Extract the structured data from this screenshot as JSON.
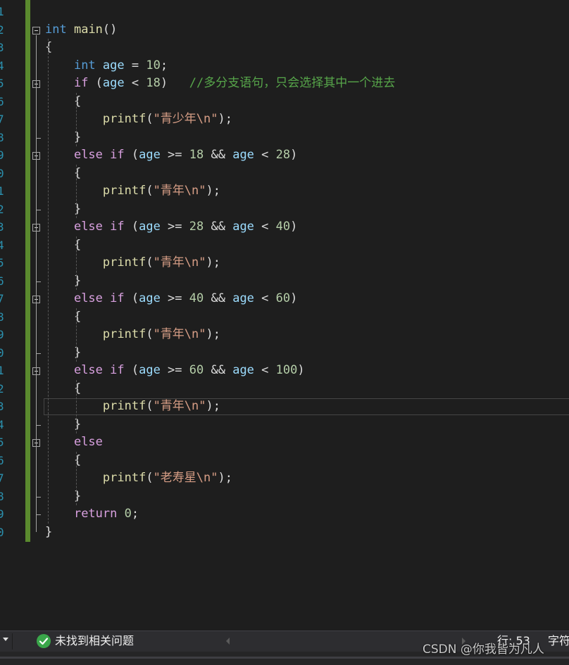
{
  "editor": {
    "line_numbers": [
      "1",
      "2",
      "3",
      "4",
      "5",
      "6",
      "7",
      "8",
      "9",
      "0",
      "1",
      "2",
      "3",
      "4",
      "5",
      "6",
      "7",
      "8",
      "9",
      "0",
      "1",
      "2",
      "3",
      "4",
      "5",
      "6",
      "7",
      "8",
      "9",
      "0"
    ],
    "lines": [
      [],
      [
        {
          "t": "kw",
          "v": "int"
        },
        {
          "t": "p",
          "v": " "
        },
        {
          "t": "fn",
          "v": "main"
        },
        {
          "t": "p",
          "v": "()"
        }
      ],
      [
        {
          "t": "p",
          "v": "{"
        }
      ],
      [
        {
          "t": "p",
          "v": "    "
        },
        {
          "t": "kw",
          "v": "int"
        },
        {
          "t": "p",
          "v": " "
        },
        {
          "t": "id",
          "v": "age"
        },
        {
          "t": "p",
          "v": " = "
        },
        {
          "t": "num",
          "v": "10"
        },
        {
          "t": "p",
          "v": ";"
        }
      ],
      [
        {
          "t": "p",
          "v": "    "
        },
        {
          "t": "ctl",
          "v": "if"
        },
        {
          "t": "p",
          "v": " ("
        },
        {
          "t": "id",
          "v": "age"
        },
        {
          "t": "p",
          "v": " < "
        },
        {
          "t": "num",
          "v": "18"
        },
        {
          "t": "p",
          "v": ")   "
        },
        {
          "t": "cm",
          "v": "//多分支语句，只会选择其中一个进去"
        }
      ],
      [
        {
          "t": "p",
          "v": "    {"
        }
      ],
      [
        {
          "t": "p",
          "v": "        "
        },
        {
          "t": "fn",
          "v": "printf"
        },
        {
          "t": "p",
          "v": "("
        },
        {
          "t": "str",
          "v": "\"青少年\\n\""
        },
        {
          "t": "p",
          "v": ");"
        }
      ],
      [
        {
          "t": "p",
          "v": "    }"
        }
      ],
      [
        {
          "t": "p",
          "v": "    "
        },
        {
          "t": "ctl",
          "v": "else if"
        },
        {
          "t": "p",
          "v": " ("
        },
        {
          "t": "id",
          "v": "age"
        },
        {
          "t": "p",
          "v": " >= "
        },
        {
          "t": "num",
          "v": "18"
        },
        {
          "t": "p",
          "v": " && "
        },
        {
          "t": "id",
          "v": "age"
        },
        {
          "t": "p",
          "v": " < "
        },
        {
          "t": "num",
          "v": "28"
        },
        {
          "t": "p",
          "v": ")"
        }
      ],
      [
        {
          "t": "p",
          "v": "    {"
        }
      ],
      [
        {
          "t": "p",
          "v": "        "
        },
        {
          "t": "fn",
          "v": "printf"
        },
        {
          "t": "p",
          "v": "("
        },
        {
          "t": "str",
          "v": "\"青年\\n\""
        },
        {
          "t": "p",
          "v": ");"
        }
      ],
      [
        {
          "t": "p",
          "v": "    }"
        }
      ],
      [
        {
          "t": "p",
          "v": "    "
        },
        {
          "t": "ctl",
          "v": "else if"
        },
        {
          "t": "p",
          "v": " ("
        },
        {
          "t": "id",
          "v": "age"
        },
        {
          "t": "p",
          "v": " >= "
        },
        {
          "t": "num",
          "v": "28"
        },
        {
          "t": "p",
          "v": " && "
        },
        {
          "t": "id",
          "v": "age"
        },
        {
          "t": "p",
          "v": " < "
        },
        {
          "t": "num",
          "v": "40"
        },
        {
          "t": "p",
          "v": ")"
        }
      ],
      [
        {
          "t": "p",
          "v": "    {"
        }
      ],
      [
        {
          "t": "p",
          "v": "        "
        },
        {
          "t": "fn",
          "v": "printf"
        },
        {
          "t": "p",
          "v": "("
        },
        {
          "t": "str",
          "v": "\"青年\\n\""
        },
        {
          "t": "p",
          "v": ");"
        }
      ],
      [
        {
          "t": "p",
          "v": "    }"
        }
      ],
      [
        {
          "t": "p",
          "v": "    "
        },
        {
          "t": "ctl",
          "v": "else if"
        },
        {
          "t": "p",
          "v": " ("
        },
        {
          "t": "id",
          "v": "age"
        },
        {
          "t": "p",
          "v": " >= "
        },
        {
          "t": "num",
          "v": "40"
        },
        {
          "t": "p",
          "v": " && "
        },
        {
          "t": "id",
          "v": "age"
        },
        {
          "t": "p",
          "v": " < "
        },
        {
          "t": "num",
          "v": "60"
        },
        {
          "t": "p",
          "v": ")"
        }
      ],
      [
        {
          "t": "p",
          "v": "    {"
        }
      ],
      [
        {
          "t": "p",
          "v": "        "
        },
        {
          "t": "fn",
          "v": "printf"
        },
        {
          "t": "p",
          "v": "("
        },
        {
          "t": "str",
          "v": "\"青年\\n\""
        },
        {
          "t": "p",
          "v": ");"
        }
      ],
      [
        {
          "t": "p",
          "v": "    }"
        }
      ],
      [
        {
          "t": "p",
          "v": "    "
        },
        {
          "t": "ctl",
          "v": "else if"
        },
        {
          "t": "p",
          "v": " ("
        },
        {
          "t": "id",
          "v": "age"
        },
        {
          "t": "p",
          "v": " >= "
        },
        {
          "t": "num",
          "v": "60"
        },
        {
          "t": "p",
          "v": " && "
        },
        {
          "t": "id",
          "v": "age"
        },
        {
          "t": "p",
          "v": " < "
        },
        {
          "t": "num",
          "v": "100"
        },
        {
          "t": "p",
          "v": ")"
        }
      ],
      [
        {
          "t": "p",
          "v": "    {"
        }
      ],
      [
        {
          "t": "p",
          "v": "        "
        },
        {
          "t": "fn",
          "v": "printf"
        },
        {
          "t": "p",
          "v": "("
        },
        {
          "t": "str",
          "v": "\"青年\\n\""
        },
        {
          "t": "p",
          "v": ");"
        }
      ],
      [
        {
          "t": "p",
          "v": "    }"
        }
      ],
      [
        {
          "t": "p",
          "v": "    "
        },
        {
          "t": "ctl",
          "v": "else"
        }
      ],
      [
        {
          "t": "p",
          "v": "    {"
        }
      ],
      [
        {
          "t": "p",
          "v": "        "
        },
        {
          "t": "fn",
          "v": "printf"
        },
        {
          "t": "p",
          "v": "("
        },
        {
          "t": "str",
          "v": "\"老寿星\\n\""
        },
        {
          "t": "p",
          "v": ");"
        }
      ],
      [
        {
          "t": "p",
          "v": "    }"
        }
      ],
      [
        {
          "t": "p",
          "v": "    "
        },
        {
          "t": "ctl",
          "v": "return"
        },
        {
          "t": "p",
          "v": " "
        },
        {
          "t": "num",
          "v": "0"
        },
        {
          "t": "p",
          "v": ";"
        }
      ],
      [
        {
          "t": "p",
          "v": "}"
        }
      ]
    ],
    "fold_lines": [
      2,
      5,
      9,
      13,
      17,
      21,
      25
    ],
    "colors": {
      "background": "#1e1e1e",
      "line_number": "#2b91af",
      "keyword": "#569cd6",
      "control": "#d8a0df",
      "identifier": "#9cdcfe",
      "function": "#dcdcaa",
      "number": "#b5cea8",
      "string": "#d69d85",
      "comment": "#57a64a",
      "change_bar": "#5a8a2e"
    }
  },
  "statusbar": {
    "issues_icon": "check-circle-icon",
    "issues_text": "未找到相关问题",
    "line_label": "行: 53",
    "char_label": "字符"
  },
  "watermark": {
    "text": "CSDN @你我皆为凡人"
  }
}
